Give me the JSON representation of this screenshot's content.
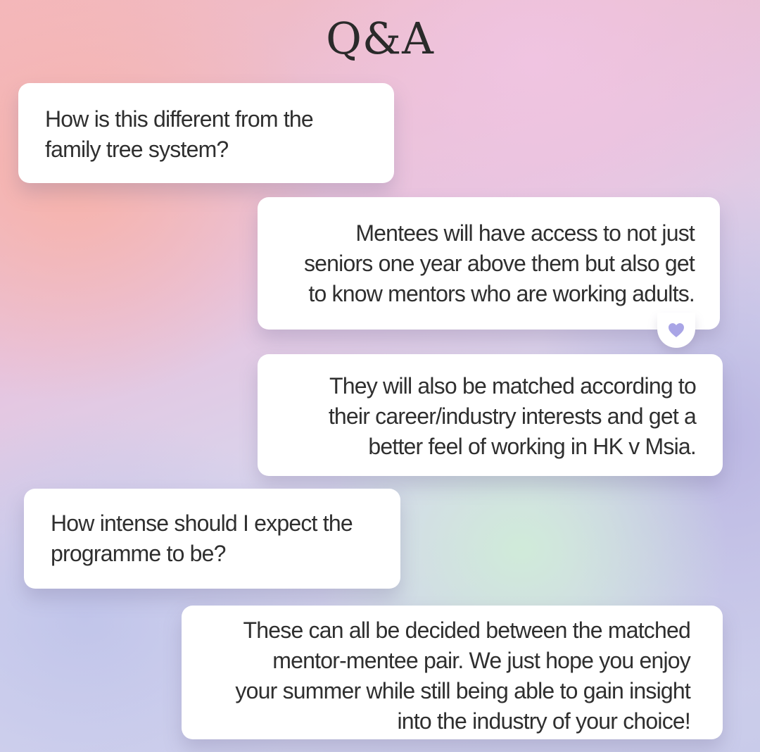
{
  "title": "Q&A",
  "messages": [
    {
      "text": "How is this different from the\nfamily tree system?"
    },
    {
      "text": "Mentees will have access to not just\nseniors one year above them but also get\nto know mentors who are working adults."
    },
    {
      "text": "They will also be matched according to\ntheir career/industry interests and get a\nbetter feel of working in HK v Msia."
    },
    {
      "text": "How intense should I expect the\nprogramme to be?"
    },
    {
      "text": "These can all be decided between the matched\nmentor-mentee pair. We just hope you enjoy\nyour summer while still being able to gain insight\ninto the industry of your choice!"
    }
  ],
  "reaction": {
    "icon": "heart-icon",
    "color": "#a9a5e6"
  }
}
